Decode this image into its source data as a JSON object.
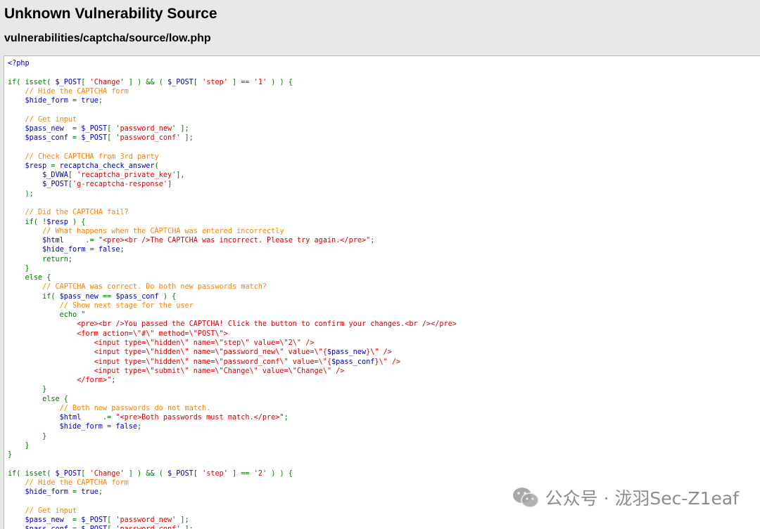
{
  "page": {
    "title": "Unknown Vulnerability Source",
    "subtitle": "vulnerabilities/captcha/source/low.php"
  },
  "colors": {
    "keyword": "#007700",
    "string": "#dd0000",
    "comment": "#ff8000",
    "variable": "#0000bb",
    "background": "#e8e8e8",
    "code_background": "#ffffff"
  },
  "code_lines": [
    [
      [
        "v",
        "<?php"
      ]
    ],
    [],
    [
      [
        "k",
        "if( isset( "
      ],
      [
        "v",
        "$_POST"
      ],
      [
        "k",
        "[ "
      ],
      [
        "s",
        "'Change'"
      ],
      [
        "k",
        " ] ) && ( "
      ],
      [
        "v",
        "$_POST"
      ],
      [
        "k",
        "[ "
      ],
      [
        "s",
        "'step'"
      ],
      [
        "k",
        " ] == "
      ],
      [
        "s",
        "'1'"
      ],
      [
        "k",
        " ) ) {"
      ]
    ],
    [
      [
        "k",
        "    "
      ],
      [
        "c",
        "// Hide the CAPTCHA form"
      ]
    ],
    [
      [
        "k",
        "    "
      ],
      [
        "v",
        "$hide_form"
      ],
      [
        "k",
        " = "
      ],
      [
        "v",
        "true"
      ],
      [
        "k",
        ";"
      ]
    ],
    [],
    [
      [
        "k",
        "    "
      ],
      [
        "c",
        "// Get input"
      ]
    ],
    [
      [
        "k",
        "    "
      ],
      [
        "v",
        "$pass_new"
      ],
      [
        "k",
        "  = "
      ],
      [
        "v",
        "$_POST"
      ],
      [
        "k",
        "[ "
      ],
      [
        "s",
        "'password_new'"
      ],
      [
        "k",
        " ];"
      ]
    ],
    [
      [
        "k",
        "    "
      ],
      [
        "v",
        "$pass_conf"
      ],
      [
        "k",
        " = "
      ],
      [
        "v",
        "$_POST"
      ],
      [
        "k",
        "[ "
      ],
      [
        "s",
        "'password_conf'"
      ],
      [
        "k",
        " ];"
      ]
    ],
    [],
    [
      [
        "k",
        "    "
      ],
      [
        "c",
        "// Check CAPTCHA from 3rd party"
      ]
    ],
    [
      [
        "k",
        "    "
      ],
      [
        "v",
        "$resp"
      ],
      [
        "k",
        " = "
      ],
      [
        "v",
        "recaptcha_check_answer"
      ],
      [
        "k",
        "("
      ]
    ],
    [
      [
        "k",
        "        "
      ],
      [
        "v",
        "$_DVWA"
      ],
      [
        "k",
        "[ "
      ],
      [
        "s",
        "'recaptcha_private_key'"
      ],
      [
        "k",
        "],"
      ]
    ],
    [
      [
        "k",
        "        "
      ],
      [
        "v",
        "$_POST"
      ],
      [
        "k",
        "["
      ],
      [
        "s",
        "'g-recaptcha-response'"
      ],
      [
        "k",
        "]"
      ]
    ],
    [
      [
        "k",
        "    );"
      ]
    ],
    [],
    [
      [
        "k",
        "    "
      ],
      [
        "c",
        "// Did the CAPTCHA fail?"
      ]
    ],
    [
      [
        "k",
        "    if( !"
      ],
      [
        "v",
        "$resp"
      ],
      [
        "k",
        " ) {"
      ]
    ],
    [
      [
        "k",
        "        "
      ],
      [
        "c",
        "// What happens when the CAPTCHA was entered incorrectly"
      ]
    ],
    [
      [
        "k",
        "        "
      ],
      [
        "v",
        "$html"
      ],
      [
        "k",
        "     .= "
      ],
      [
        "s",
        "\"<pre><br />The CAPTCHA was incorrect. Please try again.</pre>\""
      ],
      [
        "k",
        ";"
      ]
    ],
    [
      [
        "k",
        "        "
      ],
      [
        "v",
        "$hide_form"
      ],
      [
        "k",
        " = "
      ],
      [
        "v",
        "false"
      ],
      [
        "k",
        ";"
      ]
    ],
    [
      [
        "k",
        "        return;"
      ]
    ],
    [
      [
        "k",
        "    }"
      ]
    ],
    [
      [
        "k",
        "    else {"
      ]
    ],
    [
      [
        "k",
        "        "
      ],
      [
        "c",
        "// CAPTCHA was correct. Do both new passwords match?"
      ]
    ],
    [
      [
        "k",
        "        if( "
      ],
      [
        "v",
        "$pass_new"
      ],
      [
        "k",
        " == "
      ],
      [
        "v",
        "$pass_conf"
      ],
      [
        "k",
        " ) {"
      ]
    ],
    [
      [
        "k",
        "            "
      ],
      [
        "c",
        "// Show next stage for the user"
      ]
    ],
    [
      [
        "k",
        "            echo "
      ],
      [
        "s",
        "\""
      ]
    ],
    [
      [
        "s",
        "                <pre><br />You passed the CAPTCHA! Click the button to confirm your changes.<br /></pre>"
      ]
    ],
    [
      [
        "s",
        "                <form action=\\\"#\\\" method=\\\"POST\\\">"
      ]
    ],
    [
      [
        "s",
        "                    <input type=\\\"hidden\\\" name=\\\"step\\\" value=\\\"2\\\" />"
      ]
    ],
    [
      [
        "s",
        "                    <input type=\\\"hidden\\\" name=\\\"password_new\\\" value=\\\"{"
      ],
      [
        "v",
        "$pass_new"
      ],
      [
        "s",
        "}\\\" />"
      ]
    ],
    [
      [
        "s",
        "                    <input type=\\\"hidden\\\" name=\\\"password_conf\\\" value=\\\"{"
      ],
      [
        "v",
        "$pass_conf"
      ],
      [
        "s",
        "}\\\" />"
      ]
    ],
    [
      [
        "s",
        "                    <input type=\\\"submit\\\" name=\\\"Change\\\" value=\\\"Change\\\" />"
      ]
    ],
    [
      [
        "s",
        "                </form>\""
      ],
      [
        "k",
        ";"
      ]
    ],
    [
      [
        "k",
        "        }"
      ]
    ],
    [
      [
        "k",
        "        else {"
      ]
    ],
    [
      [
        "k",
        "            "
      ],
      [
        "c",
        "// Both new passwords do not match."
      ]
    ],
    [
      [
        "k",
        "            "
      ],
      [
        "v",
        "$html"
      ],
      [
        "k",
        "     .= "
      ],
      [
        "s",
        "\"<pre>Both passwords must match.</pre>\""
      ],
      [
        "k",
        ";"
      ]
    ],
    [
      [
        "k",
        "            "
      ],
      [
        "v",
        "$hide_form"
      ],
      [
        "k",
        " = "
      ],
      [
        "v",
        "false"
      ],
      [
        "k",
        ";"
      ]
    ],
    [
      [
        "k",
        "        }"
      ]
    ],
    [
      [
        "k",
        "    }"
      ]
    ],
    [
      [
        "k",
        "}"
      ]
    ],
    [],
    [
      [
        "k",
        "if( isset( "
      ],
      [
        "v",
        "$_POST"
      ],
      [
        "k",
        "[ "
      ],
      [
        "s",
        "'Change'"
      ],
      [
        "k",
        " ] ) && ( "
      ],
      [
        "v",
        "$_POST"
      ],
      [
        "k",
        "[ "
      ],
      [
        "s",
        "'step'"
      ],
      [
        "k",
        " ] == "
      ],
      [
        "s",
        "'2'"
      ],
      [
        "k",
        " ) ) {"
      ]
    ],
    [
      [
        "k",
        "    "
      ],
      [
        "c",
        "// Hide the CAPTCHA form"
      ]
    ],
    [
      [
        "k",
        "    "
      ],
      [
        "v",
        "$hide_form"
      ],
      [
        "k",
        " = "
      ],
      [
        "v",
        "true"
      ],
      [
        "k",
        ";"
      ]
    ],
    [],
    [
      [
        "k",
        "    "
      ],
      [
        "c",
        "// Get input"
      ]
    ],
    [
      [
        "k",
        "    "
      ],
      [
        "v",
        "$pass_new"
      ],
      [
        "k",
        "  = "
      ],
      [
        "v",
        "$_POST"
      ],
      [
        "k",
        "[ "
      ],
      [
        "s",
        "'password_new'"
      ],
      [
        "k",
        " ];"
      ]
    ],
    [
      [
        "k",
        "    "
      ],
      [
        "v",
        "$pass_conf"
      ],
      [
        "k",
        " = "
      ],
      [
        "v",
        "$_POST"
      ],
      [
        "k",
        "[ "
      ],
      [
        "s",
        "'password_conf'"
      ],
      [
        "k",
        " ];"
      ]
    ]
  ],
  "watermark": {
    "icon": "wechat-icon",
    "text": "公众号 · 泷羽Sec-Z1eaf"
  }
}
